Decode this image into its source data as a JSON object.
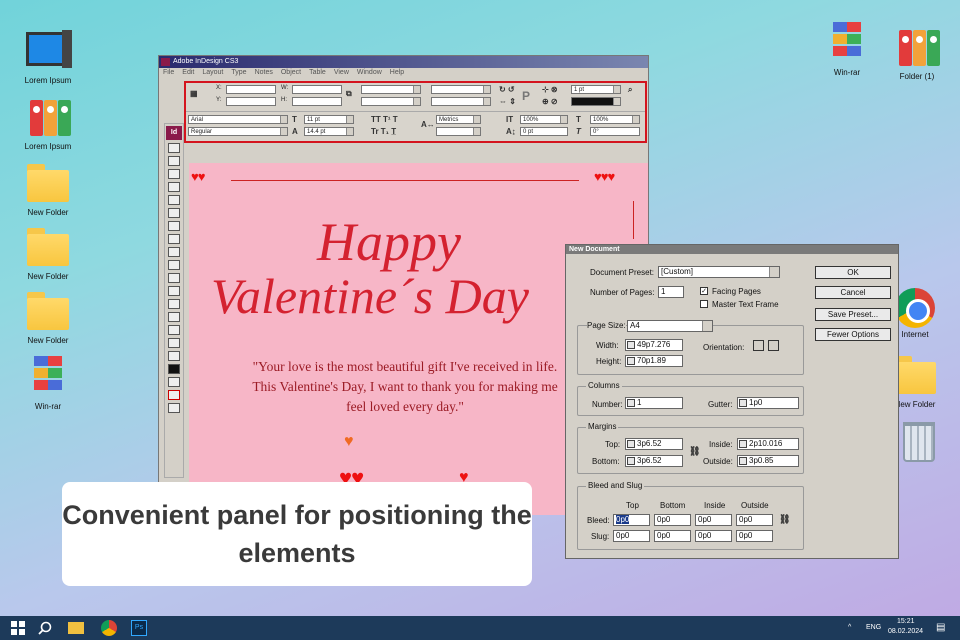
{
  "desktop": {
    "icons_left": [
      "Lorem Ipsum",
      "Lorem Ipsum",
      "New Folder",
      "New Folder",
      "New Folder",
      "Win-rar"
    ],
    "icons_right": [
      "Win-rar",
      "Folder (1)",
      "Internet",
      "New Folder"
    ]
  },
  "indesign": {
    "title": "Adobe InDesign CS3",
    "menu": [
      "File",
      "Edit",
      "Layout",
      "Type",
      "Notes",
      "Object",
      "Table",
      "View",
      "Window",
      "Help"
    ],
    "control": {
      "x_label": "X:",
      "y_label": "Y:",
      "w_label": "W:",
      "h_label": "H:",
      "stroke": "1 pt",
      "font": "Arial",
      "style": "Regular",
      "size": "11 pt",
      "leading": "14.4 pt",
      "kerning": "Metrics",
      "hscale": "100%",
      "vscale": "100%",
      "baseline": "0 pt",
      "skew": "0°"
    }
  },
  "card": {
    "title_1": "Happy",
    "title_2": "Valentine´s Day",
    "quote": "\"Your love is the most beautiful gift I've received in life. This Valentine's Day, I want to thank you for making me feel loved every day.\""
  },
  "dialog": {
    "title": "New Document",
    "preset_label": "Document Preset:",
    "preset_value": "[Custom]",
    "pages_label": "Number of Pages:",
    "pages_value": "1",
    "facing_pages": "Facing Pages",
    "master_frame": "Master Text Frame",
    "facing_checked": true,
    "master_checked": false,
    "page_size_label": "Page Size:",
    "page_size_value": "A4",
    "width_label": "Width:",
    "width_value": "49p7.276",
    "height_label": "Height:",
    "height_value": "70p1.89",
    "orientation_label": "Orientation:",
    "columns_group": "Columns",
    "number_label": "Number:",
    "number_value": "1",
    "gutter_label": "Gutter:",
    "gutter_value": "1p0",
    "margins_group": "Margins",
    "top_label": "Top:",
    "top_value": "3p6.52",
    "bottom_label": "Bottom:",
    "bottom_value": "3p6.52",
    "inside_label": "Inside:",
    "inside_value": "2p10.016",
    "outside_label": "Outside:",
    "outside_value": "3p0.85",
    "bleed_group": "Bleed and Slug",
    "col_top": "Top",
    "col_bottom": "Bottom",
    "col_inside": "Inside",
    "col_outside": "Outside",
    "bleed_label": "Bleed:",
    "slug_label": "Slug:",
    "bleed_values": [
      "0p0",
      "0p0",
      "0p0",
      "0p0"
    ],
    "slug_values": [
      "0p0",
      "0p0",
      "0p0",
      "0p0"
    ],
    "buttons": [
      "OK",
      "Cancel",
      "Save Preset...",
      "Fewer Options"
    ]
  },
  "caption": "Convenient panel for positioning the elements",
  "taskbar": {
    "lang": "ENG",
    "time": "15:21",
    "date": "08.02.2024"
  }
}
